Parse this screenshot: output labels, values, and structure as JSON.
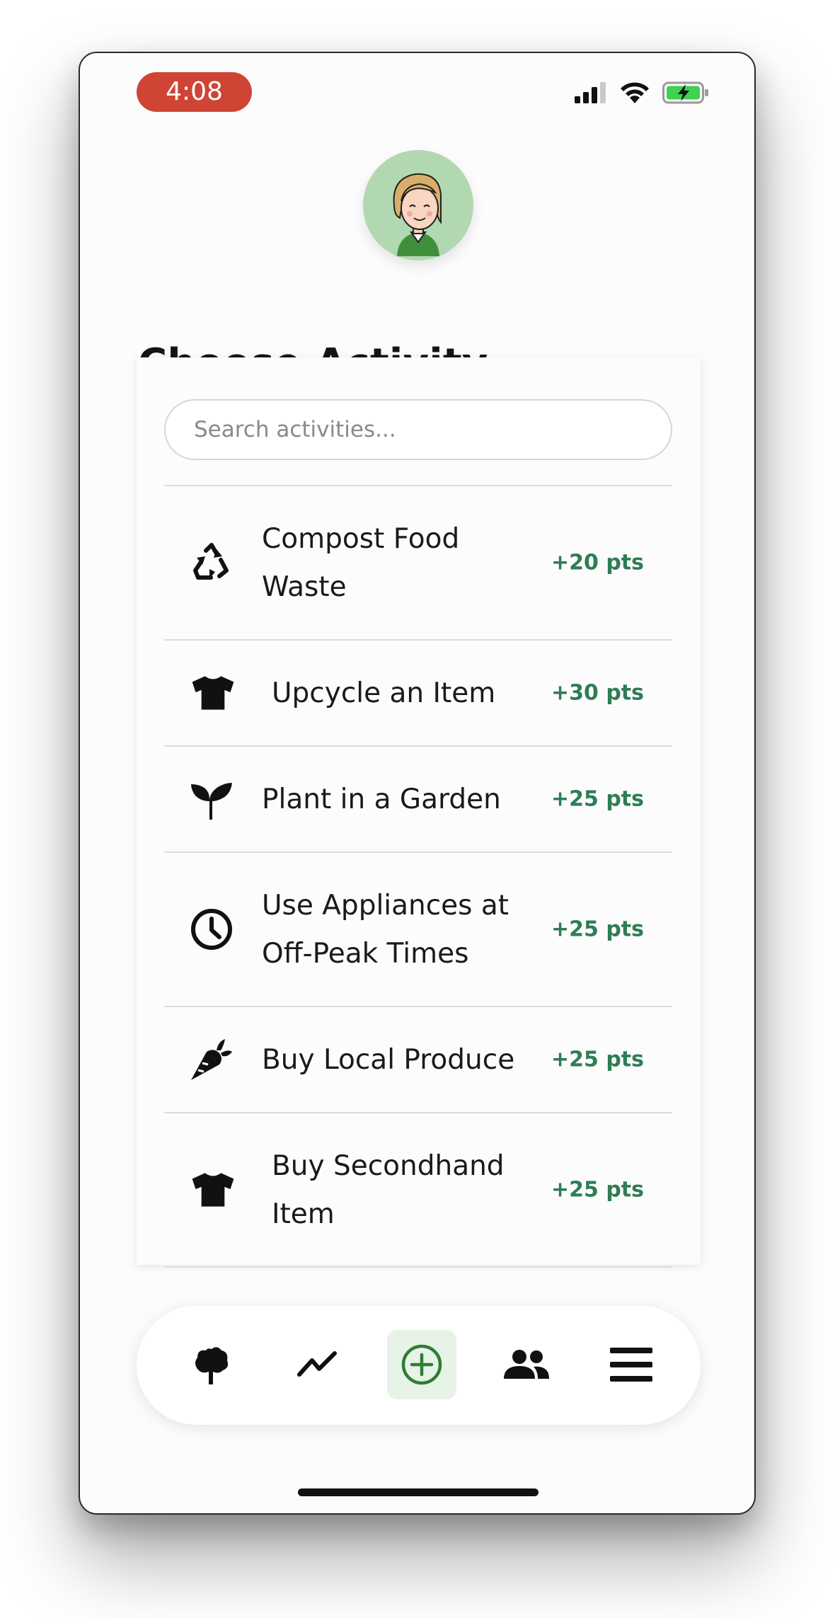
{
  "status": {
    "time": "4:08",
    "time_pill_color": "#cf4435"
  },
  "header": {
    "title": "Choose Activity",
    "avatar_icon": "user-avatar"
  },
  "search": {
    "placeholder": "Search activities..."
  },
  "activities": [
    {
      "label": "Compost Food Waste",
      "points": "+20 pts",
      "icon": "recycle-icon"
    },
    {
      "label": "Upcycle an Item",
      "points": "+30 pts",
      "icon": "tshirt-icon"
    },
    {
      "label": "Plant in a Garden",
      "points": "+25 pts",
      "icon": "seedling-icon"
    },
    {
      "label": "Use Appliances at Off-Peak Times",
      "points": "+25 pts",
      "icon": "clock-icon"
    },
    {
      "label": "Buy Local Produce",
      "points": "+25 pts",
      "icon": "carrot-icon"
    },
    {
      "label": "Buy Secondhand Item",
      "points": "+25 pts",
      "icon": "tshirt-icon"
    }
  ],
  "nav": {
    "items": [
      {
        "name": "tree-icon",
        "active": false
      },
      {
        "name": "trend-icon",
        "active": false
      },
      {
        "name": "add-circle-icon",
        "active": true
      },
      {
        "name": "people-icon",
        "active": false
      },
      {
        "name": "menu-icon",
        "active": false
      }
    ]
  },
  "colors": {
    "accent_green": "#2e7d55",
    "active_tab_bg": "#e7f3e6",
    "avatar_bg": "#b2d8b1"
  }
}
